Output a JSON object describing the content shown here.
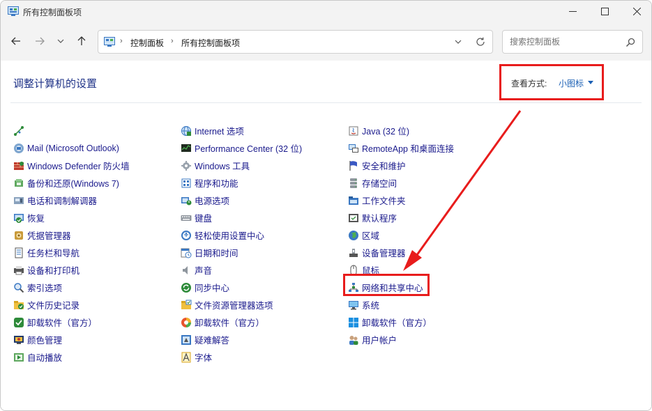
{
  "window": {
    "title": "所有控制面板项"
  },
  "address": {
    "crumbs": [
      "控制面板",
      "所有控制面板项"
    ]
  },
  "search": {
    "placeholder": "搜索控制面板"
  },
  "page": {
    "title": "调整计算机的设置",
    "view_label": "查看方式:",
    "view_value": "小图标"
  },
  "columns": [
    [
      {
        "label": "",
        "icon": "java-plugin-icon"
      },
      {
        "label": "Mail (Microsoft Outlook)",
        "icon": "mail-icon"
      },
      {
        "label": "Windows Defender 防火墙",
        "icon": "firewall-icon"
      },
      {
        "label": "备份和还原(Windows 7)",
        "icon": "backup-icon"
      },
      {
        "label": "电话和调制解调器",
        "icon": "phone-modem-icon"
      },
      {
        "label": "恢复",
        "icon": "recovery-icon"
      },
      {
        "label": "凭据管理器",
        "icon": "credential-icon"
      },
      {
        "label": "任务栏和导航",
        "icon": "taskbar-icon"
      },
      {
        "label": "设备和打印机",
        "icon": "printer-icon"
      },
      {
        "label": "索引选项",
        "icon": "index-icon"
      },
      {
        "label": "文件历史记录",
        "icon": "file-history-icon"
      },
      {
        "label": "卸载软件（官方）",
        "icon": "uninstall-icon"
      },
      {
        "label": "颜色管理",
        "icon": "color-icon"
      },
      {
        "label": "自动播放",
        "icon": "autoplay-icon"
      }
    ],
    [
      {
        "label": "Internet 选项",
        "icon": "internet-icon"
      },
      {
        "label": "Performance Center (32 位)",
        "icon": "performance-icon"
      },
      {
        "label": "Windows 工具",
        "icon": "windows-tools-icon"
      },
      {
        "label": "程序和功能",
        "icon": "programs-icon"
      },
      {
        "label": "电源选项",
        "icon": "power-icon"
      },
      {
        "label": "键盘",
        "icon": "keyboard-icon"
      },
      {
        "label": "轻松使用设置中心",
        "icon": "accessibility-icon"
      },
      {
        "label": "日期和时间",
        "icon": "datetime-icon"
      },
      {
        "label": "声音",
        "icon": "sound-icon"
      },
      {
        "label": "同步中心",
        "icon": "sync-icon"
      },
      {
        "label": "文件资源管理器选项",
        "icon": "folder-options-icon"
      },
      {
        "label": "卸载软件（官方）",
        "icon": "uninstall-shield-icon"
      },
      {
        "label": "疑难解答",
        "icon": "troubleshoot-icon"
      },
      {
        "label": "字体",
        "icon": "font-icon"
      }
    ],
    [
      {
        "label": "Java (32 位)",
        "icon": "java-icon"
      },
      {
        "label": "RemoteApp 和桌面连接",
        "icon": "remoteapp-icon"
      },
      {
        "label": "安全和维护",
        "icon": "security-flag-icon"
      },
      {
        "label": "存储空间",
        "icon": "storage-icon"
      },
      {
        "label": "工作文件夹",
        "icon": "work-folders-icon"
      },
      {
        "label": "默认程序",
        "icon": "default-programs-icon"
      },
      {
        "label": "区域",
        "icon": "region-icon"
      },
      {
        "label": "设备管理器",
        "icon": "device-manager-icon"
      },
      {
        "label": "鼠标",
        "icon": "mouse-icon"
      },
      {
        "label": "网络和共享中心",
        "icon": "network-icon"
      },
      {
        "label": "系统",
        "icon": "system-icon"
      },
      {
        "label": "卸载软件（官方）",
        "icon": "windows-logo-icon"
      },
      {
        "label": "用户帐户",
        "icon": "user-accounts-icon"
      }
    ]
  ],
  "colors": {
    "link": "#1a1a8c",
    "title": "#1e3287",
    "accent": "#1a5fb4",
    "highlight": "#e81c1c"
  }
}
